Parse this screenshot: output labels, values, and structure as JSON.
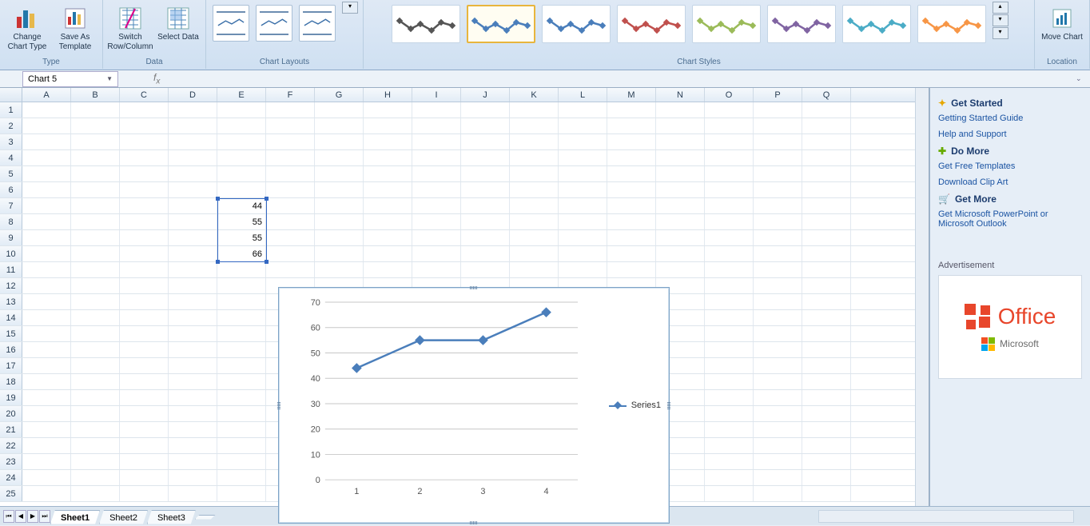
{
  "ribbon": {
    "type": {
      "change_chart_type": "Change Chart Type",
      "save_as_template": "Save As Template",
      "label": "Type"
    },
    "data": {
      "switch": "Switch Row/Column",
      "select": "Select Data",
      "label": "Data"
    },
    "layouts": {
      "label": "Chart Layouts"
    },
    "styles": {
      "label": "Chart Styles"
    },
    "location": {
      "move_chart": "Move Chart",
      "label": "Location"
    }
  },
  "namebox": "Chart 5",
  "columns": [
    "A",
    "B",
    "C",
    "D",
    "E",
    "F",
    "G",
    "H",
    "I",
    "J",
    "K",
    "L",
    "M",
    "N",
    "O",
    "P",
    "Q"
  ],
  "row_count": 25,
  "data_cells": {
    "E7": "44",
    "E8": "55",
    "E9": "55",
    "E10": "66"
  },
  "chart_data": {
    "type": "line",
    "categories": [
      "1",
      "2",
      "3",
      "4"
    ],
    "series": [
      {
        "name": "Series1",
        "values": [
          44,
          55,
          55,
          66
        ]
      }
    ],
    "y_ticks": [
      0,
      10,
      20,
      30,
      40,
      50,
      60,
      70
    ],
    "ylim": [
      0,
      70
    ]
  },
  "taskpane": {
    "get_started": "Get Started",
    "links1": [
      "Getting Started Guide",
      "Help and Support"
    ],
    "do_more": "Do More",
    "links2": [
      "Get Free Templates",
      "Download Clip Art"
    ],
    "get_more": "Get More",
    "links3": [
      "Get Microsoft PowerPoint or Microsoft Outlook"
    ],
    "ad_label": "Advertisement",
    "office": "Office",
    "microsoft": "Microsoft"
  },
  "sheets": [
    "Sheet1",
    "Sheet2",
    "Sheet3"
  ]
}
